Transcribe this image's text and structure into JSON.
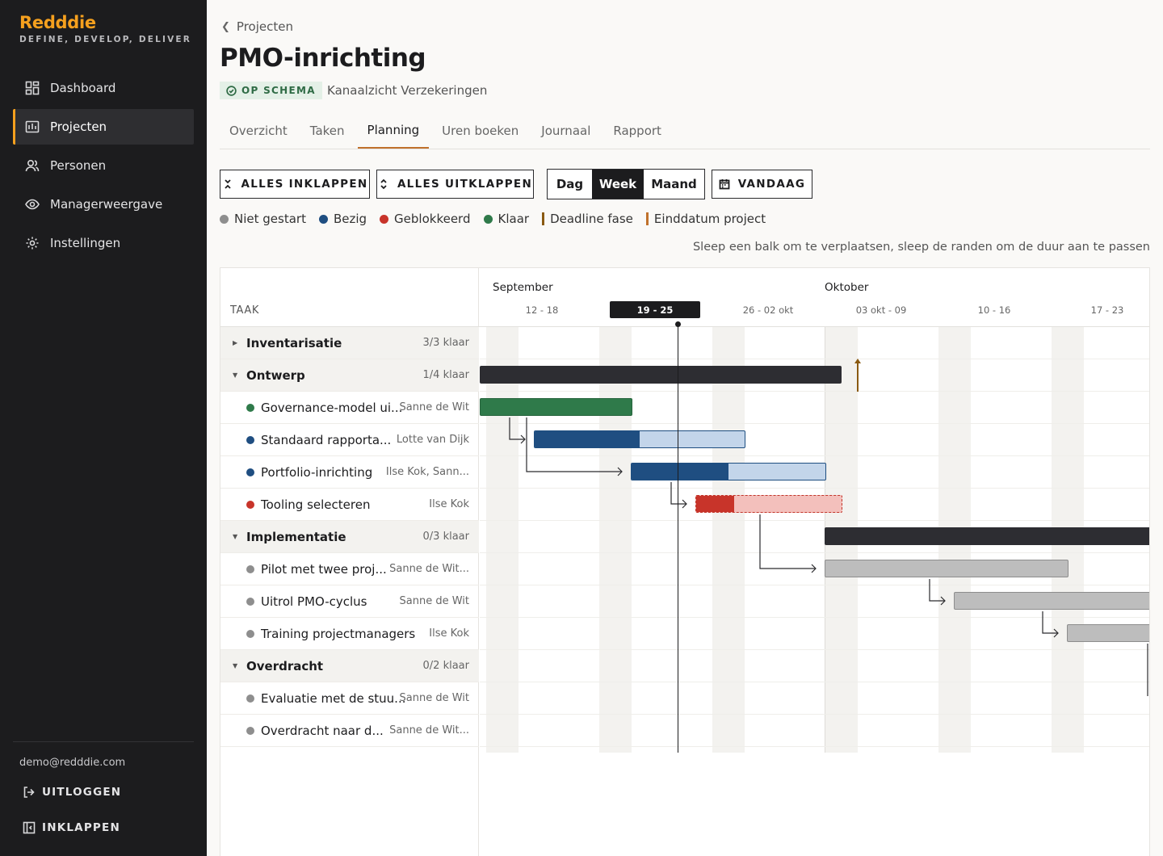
{
  "brand": {
    "name": "Redddie",
    "tagline": "DEFINE, DEVELOP, DELIVER"
  },
  "sidebar": {
    "items": [
      {
        "label": "Dashboard",
        "icon": "dashboard-icon"
      },
      {
        "label": "Projecten",
        "icon": "folder-icon",
        "active": true
      },
      {
        "label": "Personen",
        "icon": "users-icon"
      },
      {
        "label": "Managerweergave",
        "icon": "eye-icon"
      },
      {
        "label": "Instellingen",
        "icon": "gear-icon"
      }
    ],
    "email": "demo@redddie.com",
    "logout": "UITLOGGEN",
    "collapse": "INKLAPPEN"
  },
  "header": {
    "breadcrumb": "Projecten",
    "title": "PMO-inrichting",
    "status": "OP SCHEMA",
    "client": "Kanaalzicht Verzekeringen"
  },
  "tabs": [
    "Overzicht",
    "Taken",
    "Planning",
    "Uren boeken",
    "Journaal",
    "Rapport"
  ],
  "active_tab": "Planning",
  "toolbar": {
    "collapse_all": "ALLES INKLAPPEN",
    "expand_all": "ALLES UITKLAPPEN",
    "scale": [
      "Dag",
      "Week",
      "Maand"
    ],
    "scale_selected": "Week",
    "today": "VANDAAG"
  },
  "legend": [
    {
      "label": "Niet gestart",
      "type": "dot",
      "color": "#8e8e8e"
    },
    {
      "label": "Bezig",
      "type": "dot",
      "color": "#1f4e81"
    },
    {
      "label": "Geblokkeerd",
      "type": "dot",
      "color": "#c8342a"
    },
    {
      "label": "Klaar",
      "type": "dot",
      "color": "#2f7a4a"
    },
    {
      "label": "Deadline fase",
      "type": "bar",
      "color": "#8a5a12"
    },
    {
      "label": "Einddatum project",
      "type": "bar",
      "color": "#c0712c"
    }
  ],
  "hint": "Sleep een balk om te verplaatsen, sleep de randen om de duur aan te passen",
  "gantt": {
    "column_header": "TAAK",
    "months": [
      "September",
      "Oktober"
    ],
    "weeks": [
      "12 - 18",
      "19 - 25",
      "26 - 02 okt",
      "03 okt - 09",
      "10 - 16",
      "17 - 23"
    ],
    "current_week": "19 - 25",
    "rows": [
      {
        "kind": "group",
        "name": "Inventarisatie",
        "count": "3/3 klaar",
        "expanded": false
      },
      {
        "kind": "group",
        "name": "Ontwerp",
        "count": "1/4 klaar",
        "expanded": true
      },
      {
        "kind": "task",
        "name": "Governance-model ui...",
        "person": "Sanne de Wit",
        "status": "Klaar",
        "color": "#2f7a4a"
      },
      {
        "kind": "task",
        "name": "Standaard rapporta...",
        "person": "Lotte van Dijk",
        "status": "Bezig",
        "color": "#1f4e81"
      },
      {
        "kind": "task",
        "name": "Portfolio-inrichting",
        "person": "Ilse Kok, Sann...",
        "status": "Bezig",
        "color": "#1f4e81"
      },
      {
        "kind": "task",
        "name": "Tooling selecteren",
        "person": "Ilse Kok",
        "status": "Geblokkeerd",
        "color": "#c8342a"
      },
      {
        "kind": "group",
        "name": "Implementatie",
        "count": "0/3 klaar",
        "expanded": true
      },
      {
        "kind": "task",
        "name": "Pilot met twee proj...",
        "person": "Sanne de Wit...",
        "status": "Niet gestart",
        "color": "#8e8e8e"
      },
      {
        "kind": "task",
        "name": "Uitrol PMO-cyclus",
        "person": "Sanne de Wit",
        "status": "Niet gestart",
        "color": "#8e8e8e"
      },
      {
        "kind": "task",
        "name": "Training projectmanagers",
        "person": "Ilse Kok",
        "status": "Niet gestart",
        "color": "#8e8e8e"
      },
      {
        "kind": "group",
        "name": "Overdracht",
        "count": "0/2 klaar",
        "expanded": true
      },
      {
        "kind": "task",
        "name": "Evaluatie met de stuu...",
        "person": "Sanne de Wit",
        "status": "Niet gestart",
        "color": "#8e8e8e"
      },
      {
        "kind": "task",
        "name": "Overdracht naar d...",
        "person": "Sanne de Wit...",
        "status": "Niet gestart",
        "color": "#8e8e8e"
      }
    ]
  }
}
